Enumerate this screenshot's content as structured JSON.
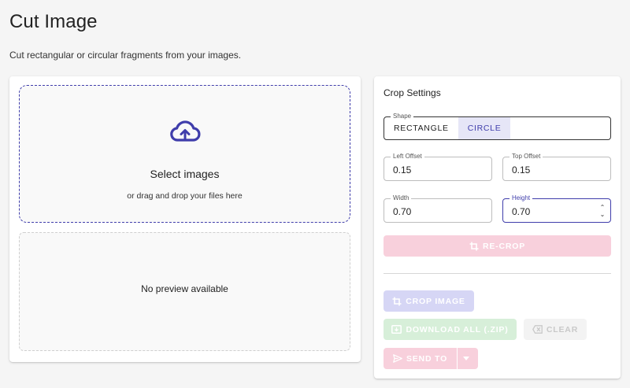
{
  "page": {
    "title": "Cut Image",
    "description": "Cut rectangular or circular fragments from your images."
  },
  "upload": {
    "title": "Select images",
    "subtitle": "or drag and drop your files here",
    "icon": "cloud-upload-icon"
  },
  "preview": {
    "empty_text": "No preview available"
  },
  "settings": {
    "title": "Crop Settings",
    "shape": {
      "label": "Shape",
      "options": [
        "RECTANGLE",
        "CIRCLE"
      ],
      "selected": "CIRCLE"
    },
    "left_offset": {
      "label": "Left Offset",
      "value": "0.15"
    },
    "top_offset": {
      "label": "Top Offset",
      "value": "0.15"
    },
    "width": {
      "label": "Width",
      "value": "0.70"
    },
    "height": {
      "label": "Height",
      "value": "0.70"
    },
    "stepper_up": "⌃",
    "stepper_down": "⌄"
  },
  "actions": {
    "recrop": "RE-CROP",
    "crop_image": "CROP IMAGE",
    "download_all": "DOWNLOAD ALL (.ZIP)",
    "clear": "CLEAR",
    "send_to": "SEND TO"
  },
  "colors": {
    "accent": "#3f3dab",
    "pink_disabled": "#f8d0dc",
    "indigo_disabled": "#d6d6f5",
    "green_disabled": "#d7efd9"
  }
}
